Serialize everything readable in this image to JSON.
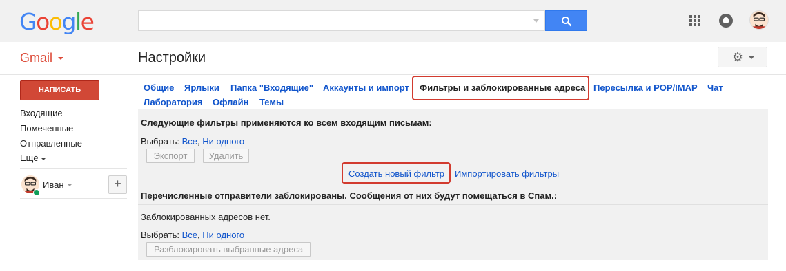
{
  "header": {
    "logo_letters": [
      {
        "ch": "G",
        "color": "#4285f4"
      },
      {
        "ch": "o",
        "color": "#ea4335"
      },
      {
        "ch": "o",
        "color": "#fbbc05"
      },
      {
        "ch": "g",
        "color": "#4285f4"
      },
      {
        "ch": "l",
        "color": "#34a853"
      },
      {
        "ch": "e",
        "color": "#ea4335"
      }
    ],
    "search_value": "",
    "search_icon": "search-icon",
    "apps_icon": "apps-grid-icon",
    "notifications_icon": "bell-icon"
  },
  "app": {
    "name": "Gmail",
    "page_title": "Настройки",
    "accent_color": "#dd4b39"
  },
  "sidebar": {
    "compose_label": "НАПИСАТЬ",
    "items": [
      {
        "label": "Входящие"
      },
      {
        "label": "Помеченные"
      },
      {
        "label": "Отправленные"
      },
      {
        "label": "Ещё"
      }
    ],
    "hangouts_user": "Иван"
  },
  "tabs": [
    {
      "label": "Общие"
    },
    {
      "label": "Ярлыки"
    },
    {
      "label": "Папка \"Входящие\""
    },
    {
      "label": "Аккаунты и импорт"
    },
    {
      "label": "Фильтры и заблокированные адреса",
      "active": true
    },
    {
      "label": "Пересылка и POP/IMAP"
    },
    {
      "label": "Чат"
    },
    {
      "label": "Лаборатория"
    },
    {
      "label": "Офлайн"
    },
    {
      "label": "Темы"
    }
  ],
  "filters": {
    "heading": "Следующие фильтры применяются ко всем входящим письмам:",
    "select_label": "Выбрать:",
    "select_all": "Все",
    "select_none": "Ни одного",
    "export_label": "Экспорт",
    "delete_label": "Удалить",
    "create_filter_label": "Создать новый фильтр",
    "import_filters_label": "Импортировать фильтры"
  },
  "blocked": {
    "heading": "Перечисленные отправители заблокированы. Сообщения от них будут помещаться в Спам.:",
    "empty_text": "Заблокированных адресов нет.",
    "select_label": "Выбрать:",
    "select_all": "Все",
    "select_none": "Ни одного",
    "unblock_label": "Разблокировать выбранные адреса"
  },
  "highlight_color": "#d23b2f"
}
